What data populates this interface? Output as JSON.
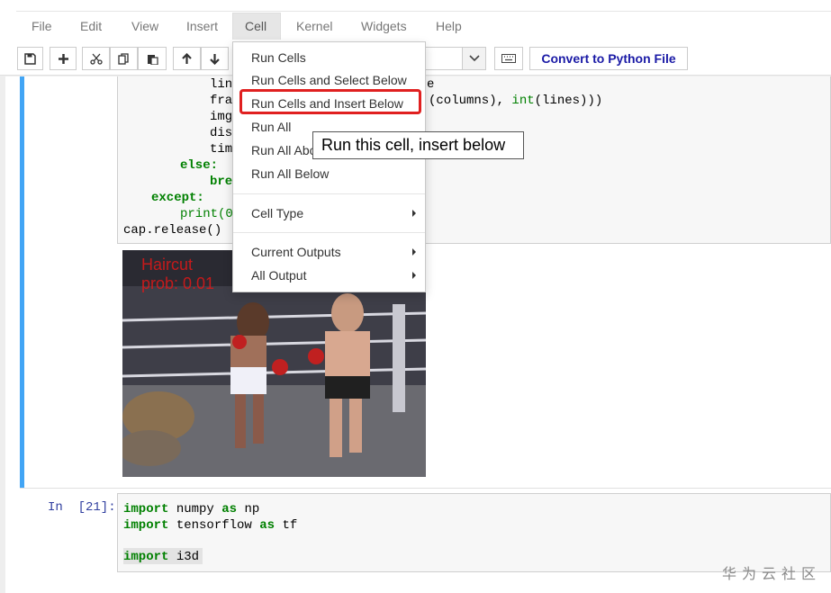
{
  "menubar": {
    "items": [
      "File",
      "Edit",
      "View",
      "Insert",
      "Cell",
      "Kernel",
      "Widgets",
      "Help"
    ]
  },
  "toolbar": {
    "convert_label": "Convert to Python File",
    "icons": [
      "save-icon",
      "plus-icon",
      "cut-icon",
      "copy-icon",
      "paste-icon",
      "arrow-up-icon",
      "arrow-down-icon",
      "keyboard-icon"
    ]
  },
  "cell_menu": {
    "items": [
      {
        "label": "Run Cells"
      },
      {
        "label": "Run Cells and Select Below"
      },
      {
        "label": "Run Cells and Insert Below",
        "highlighted": true
      },
      {
        "label": "Run All"
      },
      {
        "label": "Run All Above"
      },
      {
        "label": "Run All Below"
      },
      {
        "label": "Cell Type",
        "submenu": true
      },
      {
        "label": "Current Outputs",
        "submenu": true
      },
      {
        "label": "All Output",
        "submenu": true
      }
    ],
    "tooltip": "Run this cell, insert below",
    "highlight_color": "#e02020"
  },
  "cell1": {
    "code_lines": [
      "lin",
      "fra",
      "img",
      "dis",
      "tim",
      "else:",
      "bre",
      "except:",
      "print(0",
      "cap.release()"
    ],
    "code_fragments": {
      "line0_tail": "e",
      "line1_tail": "(columns), int(lines)))"
    },
    "output_overlay": [
      "Haircut",
      "prob: 0.01"
    ]
  },
  "cell2": {
    "prompt": "In  [21]:",
    "code_lines": [
      "import numpy as np",
      "import tensorflow as tf",
      "",
      "import i3d"
    ]
  },
  "watermark": "华为云社区",
  "colors": {
    "selected_bar": "#42a5f5",
    "keyword": "#008000",
    "prompt": "#303f9f",
    "convert_text": "#1a1aa6"
  }
}
